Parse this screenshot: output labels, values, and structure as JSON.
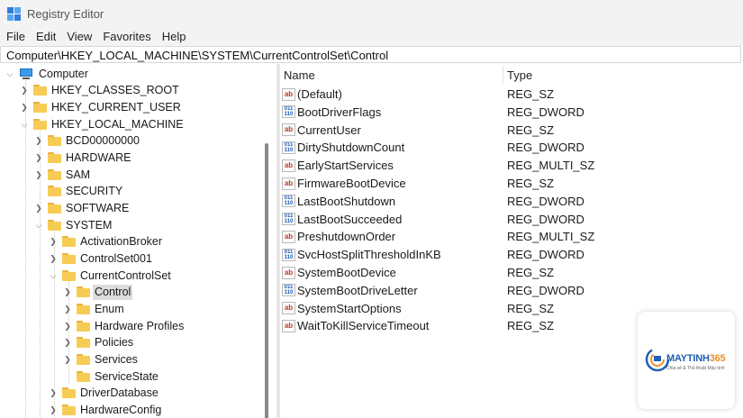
{
  "window": {
    "title": "Registry Editor",
    "icon": "registry-icon",
    "accent": "#2b7de0"
  },
  "menu": [
    "File",
    "Edit",
    "View",
    "Favorites",
    "Help"
  ],
  "address": {
    "path": "Computer\\HKEY_LOCAL_MACHINE\\SYSTEM\\CurrentControlSet\\Control"
  },
  "tree": {
    "root": "Computer",
    "nodes": [
      {
        "label": "HKEY_CLASSES_ROOT",
        "expanded": false
      },
      {
        "label": "HKEY_CURRENT_USER",
        "expanded": false
      },
      {
        "label": "HKEY_LOCAL_MACHINE",
        "expanded": true
      },
      {
        "label": "BCD00000000",
        "expanded": false
      },
      {
        "label": "HARDWARE",
        "expanded": false
      },
      {
        "label": "SAM",
        "expanded": false
      },
      {
        "label": "SECURITY",
        "expanded": false
      },
      {
        "label": "SOFTWARE",
        "expanded": false
      },
      {
        "label": "SYSTEM",
        "expanded": true
      },
      {
        "label": "ActivationBroker",
        "expanded": false
      },
      {
        "label": "ControlSet001",
        "expanded": false
      },
      {
        "label": "CurrentControlSet",
        "expanded": true
      },
      {
        "label": "Control",
        "expanded": false,
        "selected": true
      },
      {
        "label": "Enum",
        "expanded": false
      },
      {
        "label": "Hardware Profiles",
        "expanded": false
      },
      {
        "label": "Policies",
        "expanded": false
      },
      {
        "label": "Services",
        "expanded": false
      },
      {
        "label": "ServiceState",
        "expanded": false
      },
      {
        "label": "DriverDatabase",
        "expanded": false
      },
      {
        "label": "HardwareConfig",
        "expanded": false
      }
    ]
  },
  "list": {
    "columns": {
      "name": "Name",
      "type": "Type"
    },
    "rows": [
      {
        "name": "(Default)",
        "type": "REG_SZ",
        "icon": "string-value-icon"
      },
      {
        "name": "BootDriverFlags",
        "type": "REG_DWORD",
        "icon": "binary-value-icon"
      },
      {
        "name": "CurrentUser",
        "type": "REG_SZ",
        "icon": "string-value-icon"
      },
      {
        "name": "DirtyShutdownCount",
        "type": "REG_DWORD",
        "icon": "binary-value-icon"
      },
      {
        "name": "EarlyStartServices",
        "type": "REG_MULTI_SZ",
        "icon": "string-value-icon"
      },
      {
        "name": "FirmwareBootDevice",
        "type": "REG_SZ",
        "icon": "string-value-icon"
      },
      {
        "name": "LastBootShutdown",
        "type": "REG_DWORD",
        "icon": "binary-value-icon"
      },
      {
        "name": "LastBootSucceeded",
        "type": "REG_DWORD",
        "icon": "binary-value-icon"
      },
      {
        "name": "PreshutdownOrder",
        "type": "REG_MULTI_SZ",
        "icon": "string-value-icon"
      },
      {
        "name": "SvcHostSplitThresholdInKB",
        "type": "REG_DWORD",
        "icon": "binary-value-icon"
      },
      {
        "name": "SystemBootDevice",
        "type": "REG_SZ",
        "icon": "string-value-icon"
      },
      {
        "name": "SystemBootDriveLetter",
        "type": "REG_DWORD",
        "icon": "binary-value-icon"
      },
      {
        "name": "SystemStartOptions",
        "type": "REG_SZ",
        "icon": "string-value-icon"
      },
      {
        "name": "WaitToKillServiceTimeout",
        "type": "REG_SZ",
        "icon": "string-value-icon"
      }
    ]
  },
  "watermark": {
    "brand_a": "MAYTINH",
    "brand_b": "365",
    "tagline": "Chia sẻ & Thủ thuật Máy tính"
  }
}
